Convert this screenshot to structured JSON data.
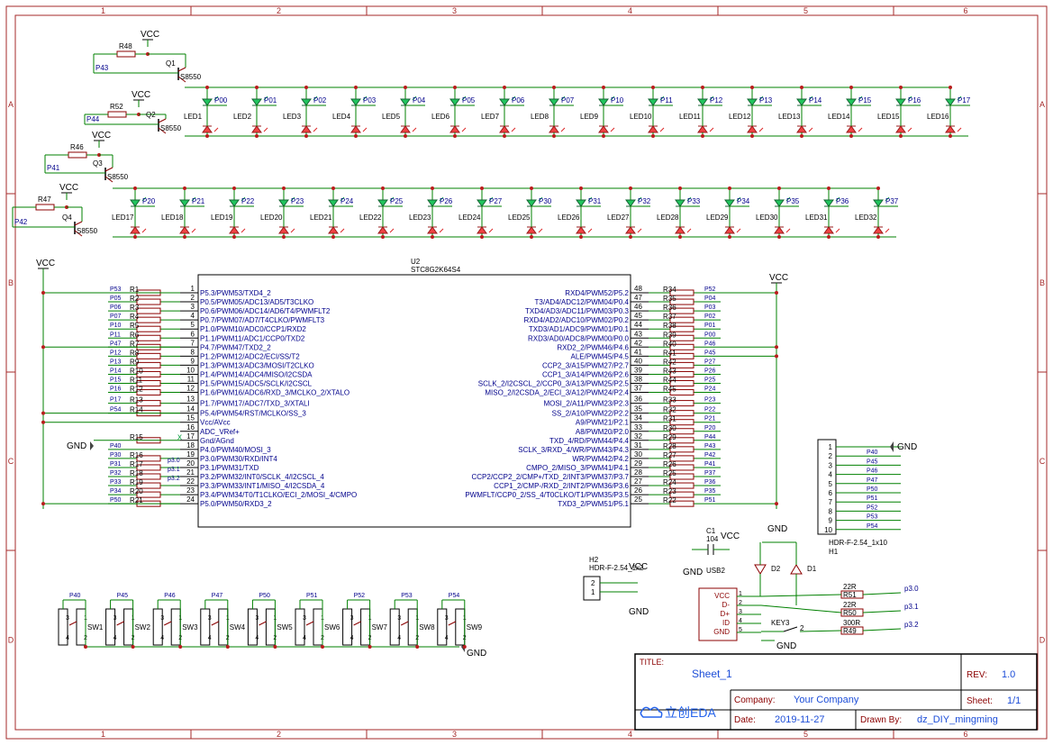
{
  "frame": {
    "col_labels": [
      "1",
      "2",
      "3",
      "4",
      "5",
      "6"
    ],
    "row_labels": [
      "A",
      "B",
      "C",
      "D"
    ],
    "border_color": "#a52a2a"
  },
  "colors": {
    "wire": "#008000",
    "part": "#8b0000",
    "label": "#00008b",
    "pin": "#000",
    "led_top": "#22c55e",
    "led_bot": "#ef4444"
  },
  "row1_driver": {
    "resistor": "R48",
    "vcc": "VCC",
    "net": "P43",
    "transistor": "Q1",
    "model": "S8550"
  },
  "row2_driver": {
    "resistor": "R52",
    "vcc": "VCC",
    "net": "P44",
    "transistor": "Q2",
    "model": "S8550"
  },
  "row3_driver": {
    "resistor": "R46",
    "vcc": "VCC",
    "net": "P41",
    "transistor": "Q3",
    "model": "S8550"
  },
  "row4_driver": {
    "resistor": "R47",
    "vcc": "VCC",
    "net": "P42",
    "transistor": "Q4",
    "model": "S8550"
  },
  "led_row1": {
    "leds": [
      "LED1",
      "LED2",
      "LED3",
      "LED4",
      "LED5",
      "LED6",
      "LED7",
      "LED8",
      "LED9",
      "LED10",
      "LED11",
      "LED12",
      "LED13",
      "LED14",
      "LED15",
      "LED16"
    ],
    "nets": [
      "P00",
      "P01",
      "P02",
      "P03",
      "P04",
      "P05",
      "P06",
      "P07",
      "P10",
      "P11",
      "P12",
      "P13",
      "P14",
      "P15",
      "P16",
      "P17"
    ]
  },
  "led_row2": {
    "leds": [
      "LED17",
      "LED18",
      "LED19",
      "LED20",
      "LED21",
      "LED22",
      "LED23",
      "LED24",
      "LED25",
      "LED26",
      "LED27",
      "LED28",
      "LED29",
      "LED30",
      "LED31",
      "LED32"
    ],
    "nets": [
      "P20",
      "P21",
      "P22",
      "P23",
      "P24",
      "P25",
      "P26",
      "P27",
      "P30",
      "P31",
      "P32",
      "P33",
      "P34",
      "P35",
      "P36",
      "P37"
    ]
  },
  "mcu": {
    "ref": "U2",
    "part": "STC8G2K64S4",
    "left_pins": [
      {
        "n": "1",
        "name": "P5.3/PWM53/TXD4_2",
        "res": "R1",
        "net": "P53"
      },
      {
        "n": "2",
        "name": "P0.5/PWM05/ADC13/AD5/T3CLKO",
        "res": "R2",
        "net": "P05"
      },
      {
        "n": "3",
        "name": "P0.6/PWM06/ADC14/AD6/T4/PWMFLT2",
        "res": "R3",
        "net": "P06"
      },
      {
        "n": "4",
        "name": "P0.7/PWM07/AD7/T4CLKO/PWMFLT3",
        "res": "R4",
        "net": "P07"
      },
      {
        "n": "5",
        "name": "P1.0/PWM10/ADC0/CCP1/RXD2",
        "res": "R5",
        "net": "P10"
      },
      {
        "n": "6",
        "name": "P1.1/PWM11/ADC1/CCP0/TXD2",
        "res": "R6",
        "net": "P11"
      },
      {
        "n": "7",
        "name": "P4.7/PWM47/TXD2_2",
        "res": "R7",
        "net": "P47"
      },
      {
        "n": "8",
        "name": "P1.2/PWM12/ADC2/ECI/SS/T2",
        "res": "R8",
        "net": "P12"
      },
      {
        "n": "9",
        "name": "P1.3/PWM13/ADC3/MOSI/T2CLKO",
        "res": "R9",
        "net": "P13"
      },
      {
        "n": "10",
        "name": "P1.4/PWM14/ADC4/MISO/I2CSDA",
        "res": "R10",
        "net": "P14"
      },
      {
        "n": "11",
        "name": "P1.5/PWM15/ADC5/SCLK/I2CSCL",
        "res": "R11",
        "net": "P15"
      },
      {
        "n": "12",
        "name": "P1.6/PWM16/ADC6/RXD_3/MCLKO_2/XTALO",
        "res": "R12",
        "net": "P16"
      },
      {
        "n": "13",
        "name": "P1.7/PWM17/ADC7/TXD_3/XTALI",
        "res": "R13",
        "net": "P17"
      },
      {
        "n": "14",
        "name": "P5.4/PWM54/RST/MCLKO/SS_3",
        "res": "R14",
        "net": "P54"
      },
      {
        "n": "15",
        "name": "Vcc/AVcc",
        "res": "",
        "net": ""
      },
      {
        "n": "16",
        "name": "ADC_VRef+",
        "res": "",
        "net": ""
      },
      {
        "n": "17",
        "name": "Gnd/AGnd",
        "res": "R15",
        "net": ""
      },
      {
        "n": "18",
        "name": "P4.0/PWM40/MOSI_3",
        "res": "",
        "net": "P40"
      },
      {
        "n": "19",
        "name": "P3.0/PWM30/RXD/INT4",
        "res": "R16",
        "net": "P30"
      },
      {
        "n": "20",
        "name": "P3.1/PWM31/TXD",
        "res": "R17",
        "net": "P31"
      },
      {
        "n": "21",
        "name": "P3.2/PWM32/INT0/SCLK_4/I2CSCL_4",
        "res": "R18",
        "net": "P32"
      },
      {
        "n": "22",
        "name": "P3.3/PWM33/INT1/MISO_4/I2CSDA_4",
        "res": "R19",
        "net": "P33"
      },
      {
        "n": "23",
        "name": "P3.4/PWM34/T0/T1CLKO/ECI_2/MOSI_4/CMPO",
        "res": "R20",
        "net": "P34"
      },
      {
        "n": "24",
        "name": "P5.0/PWM50/RXD3_2",
        "res": "R21",
        "net": "P50"
      }
    ],
    "right_pins": [
      {
        "n": "48",
        "name": "RXD4/PWM52/P5.2",
        "res": "R34",
        "net": "P52"
      },
      {
        "n": "47",
        "name": "T3/AD4/ADC12/PWM04/P0.4",
        "res": "R35",
        "net": "P04"
      },
      {
        "n": "46",
        "name": "TXD4/AD3/ADC11/PWM03/P0.3",
        "res": "R36",
        "net": "P03"
      },
      {
        "n": "45",
        "name": "RXD4/AD2/ADC10/PWM02/P0.2",
        "res": "R37",
        "net": "P02"
      },
      {
        "n": "44",
        "name": "TXD3/AD1/ADC9/PWM01/P0.1",
        "res": "R38",
        "net": "P01"
      },
      {
        "n": "43",
        "name": "RXD3/AD0/ADC8/PWM00/P0.0",
        "res": "R39",
        "net": "P00"
      },
      {
        "n": "42",
        "name": "RXD2_2/PWM46/P4.6",
        "res": "R40",
        "net": "P46"
      },
      {
        "n": "41",
        "name": "ALE/PWM45/P4.5",
        "res": "R41",
        "net": "P45"
      },
      {
        "n": "40",
        "name": "CCP2_3/A15/PWM27/P2.7",
        "res": "R42",
        "net": "P27"
      },
      {
        "n": "39",
        "name": "CCP1_3/A14/PWM26/P2.6",
        "res": "R43",
        "net": "P26"
      },
      {
        "n": "38",
        "name": "SCLK_2/I2CSCL_2/CCP0_3/A13/PWM25/P2.5",
        "res": "R44",
        "net": "P25"
      },
      {
        "n": "37",
        "name": "MISO_2/I2CSDA_2/ECI_3/A12/PWM24/P2.4",
        "res": "R45",
        "net": "P24"
      },
      {
        "n": "36",
        "name": "MOSI_2/A11/PWM23/P2.3",
        "res": "R33",
        "net": "P23"
      },
      {
        "n": "35",
        "name": "SS_2/A10/PWM22/P2.2",
        "res": "R32",
        "net": "P22"
      },
      {
        "n": "34",
        "name": "A9/PWM21/P2.1",
        "res": "R31",
        "net": "P21"
      },
      {
        "n": "33",
        "name": "A8/PWM20/P2.0",
        "res": "R30",
        "net": "P20"
      },
      {
        "n": "32",
        "name": "TXD_4/RD/PWM44/P4.4",
        "res": "R29",
        "net": "P44"
      },
      {
        "n": "31",
        "name": "SCLK_3/RXD_4/WR/PWM43/P4.3",
        "res": "R28",
        "net": "P43"
      },
      {
        "n": "30",
        "name": "WR/PWM42/P4.2",
        "res": "R27",
        "net": "P42"
      },
      {
        "n": "29",
        "name": "CMPO_2/MISO_3/PWM41/P4.1",
        "res": "R26",
        "net": "P41"
      },
      {
        "n": "28",
        "name": "CCP2/CCP2_2/CMP+/TXD_2/INT3/PWM37/P3.7",
        "res": "R25",
        "net": "P37"
      },
      {
        "n": "27",
        "name": "CCP1_2/CMP-/RXD_2/INT2/PWM36/P3.6",
        "res": "R24",
        "net": "P36"
      },
      {
        "n": "26",
        "name": "PWMFLT/CCP0_2/SS_4/T0CLKO/T1/PWM35/P3.5",
        "res": "R23",
        "net": "P35"
      },
      {
        "n": "25",
        "name": "TXD3_2/PWM51/P5.1",
        "res": "R22",
        "net": "P51"
      }
    ],
    "p3_labels": [
      "p3.0",
      "p3.1",
      "p3.2"
    ],
    "vcc": "VCC",
    "gnd": "GND"
  },
  "header_h1": {
    "ref": "H1",
    "part": "HDR-F-2.54_1x10",
    "pins": [
      "1",
      "2",
      "3",
      "4",
      "5",
      "6",
      "7",
      "8",
      "9",
      "10"
    ],
    "nets": [
      "P40",
      "P45",
      "P46",
      "P47",
      "P50",
      "P51",
      "P52",
      "P53",
      "P54"
    ],
    "gnd": "GND"
  },
  "header_h2": {
    "ref": "H2",
    "part": "HDR-F-2.54_1x2",
    "pins": [
      "2",
      "1"
    ],
    "vcc": "VCC",
    "gnd": "GND"
  },
  "usb": {
    "ref": "USB2",
    "pins": [
      "VCC",
      "D-",
      "D+",
      "ID",
      "GND"
    ],
    "nums": [
      "1",
      "2",
      "3",
      "4",
      "5"
    ],
    "c1": "C1",
    "c1_val": "104",
    "vcc": "VCC",
    "gnd": "GND",
    "d1": "D1",
    "d2": "D2",
    "r51": "R51",
    "r51_val": "22R",
    "r50": "R50",
    "r50_val": "22R",
    "r49": "R49",
    "r49_val": "300R",
    "nets": [
      "p3.0",
      "p3.1",
      "p3.2"
    ],
    "key": "KEY3",
    "key_pin": "2",
    "gnd_top": "GND",
    "gnd_bot": "GND"
  },
  "switches": {
    "refs": [
      "SW1",
      "SW2",
      "SW3",
      "SW4",
      "SW5",
      "SW6",
      "SW7",
      "SW8",
      "SW9"
    ],
    "nets": [
      "P40",
      "P45",
      "P46",
      "P47",
      "P50",
      "P51",
      "P52",
      "P53",
      "P54"
    ],
    "pins": [
      "3",
      "4",
      "1",
      "2"
    ],
    "gnd": "GND"
  },
  "title_block": {
    "title_label": "TITLE:",
    "title": "Sheet_1",
    "rev_label": "REV:",
    "rev": "1.0",
    "company_label": "Company:",
    "company": "Your Company",
    "sheet_label": "Sheet:",
    "sheet": "1/1",
    "date_label": "Date:",
    "date": "2019-11-27",
    "drawn_label": "Drawn By:",
    "drawn": "dz_DIY_mingming",
    "logo": "立创EDA"
  }
}
